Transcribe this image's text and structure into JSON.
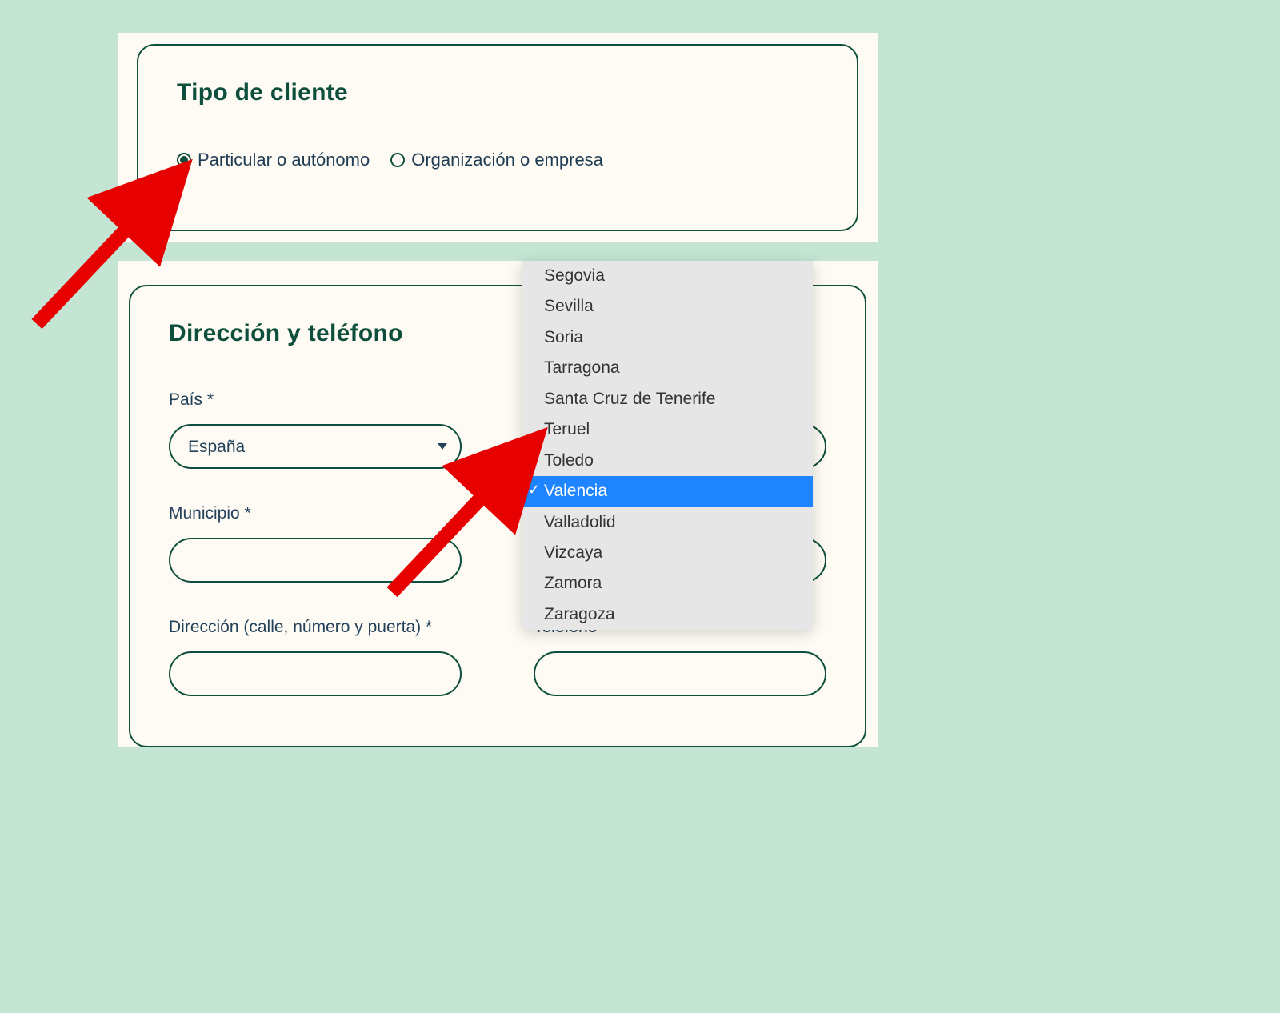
{
  "client_type": {
    "title": "Tipo de cliente",
    "options": {
      "particular": "Particular o autónomo",
      "org": "Organización o empresa"
    },
    "selected": "particular"
  },
  "address": {
    "title": "Dirección y teléfono",
    "labels": {
      "pais": "País *",
      "municipio": "Municipio *",
      "direccion": "Dirección (calle, número y puerta) *",
      "telefono": "Teléfono *"
    },
    "values": {
      "pais": "España",
      "municipio": "",
      "direccion": "",
      "telefono": ""
    }
  },
  "dropdown": {
    "items": [
      "Segovia",
      "Sevilla",
      "Soria",
      "Tarragona",
      "Santa Cruz de Tenerife",
      "Teruel",
      "Toledo",
      "Valencia",
      "Valladolid",
      "Vizcaya",
      "Zamora",
      "Zaragoza"
    ],
    "selected": "Valencia"
  }
}
